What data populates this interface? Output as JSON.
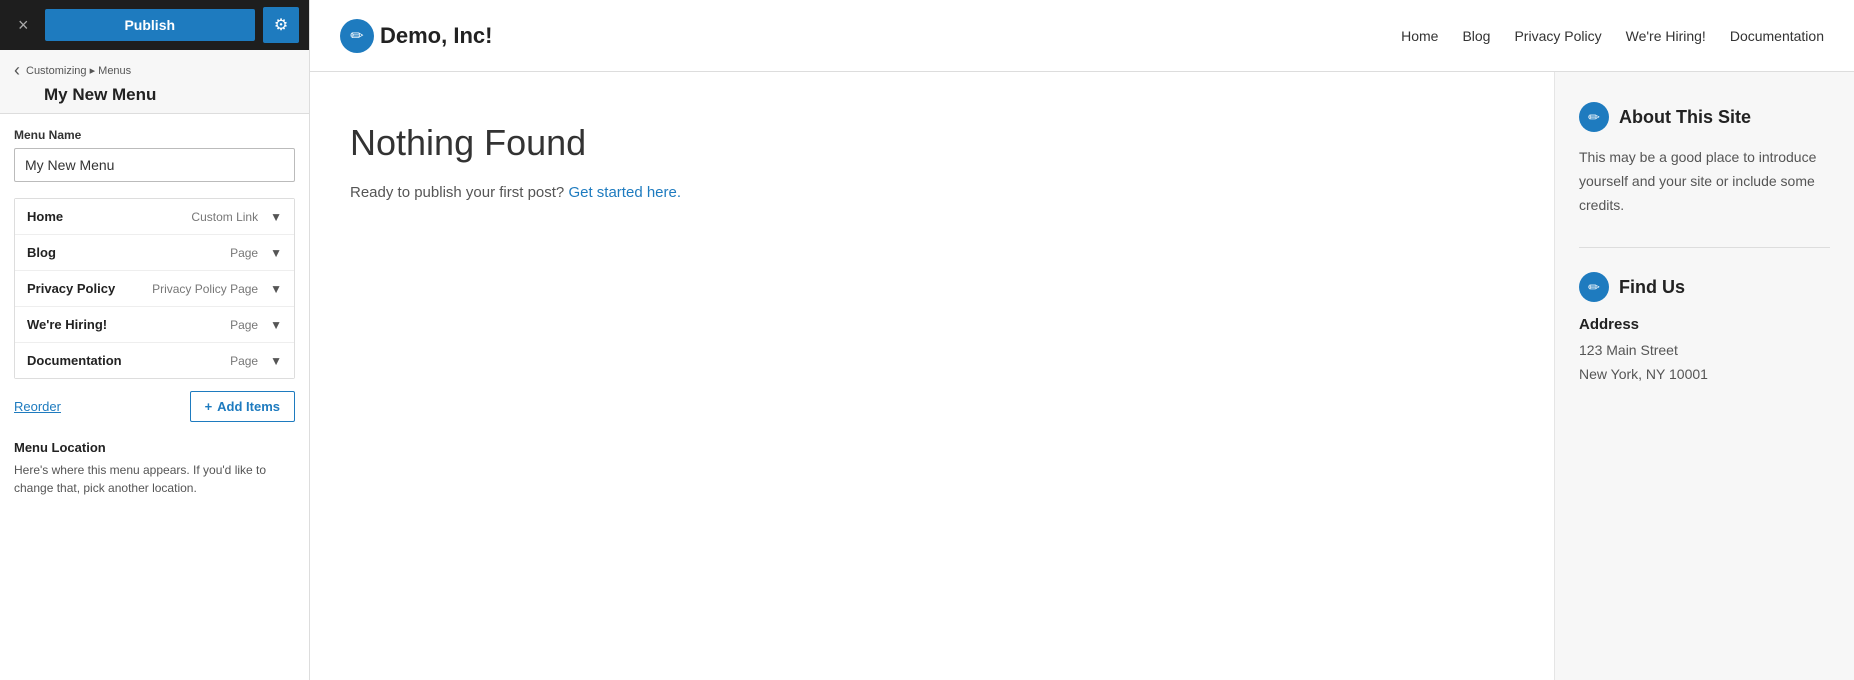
{
  "topbar": {
    "close_icon": "×",
    "publish_label": "Publish",
    "gear_icon": "⚙"
  },
  "sidebar": {
    "back_icon": "‹",
    "breadcrumb": "Customizing ▸ Menus",
    "section_title": "My New Menu",
    "menu_name_label": "Menu Name",
    "menu_name_value": "My New Menu",
    "menu_items": [
      {
        "name": "Home",
        "type": "Custom Link"
      },
      {
        "name": "Blog",
        "type": "Page"
      },
      {
        "name": "Privacy Policy",
        "type": "Privacy Policy Page"
      },
      {
        "name": "We're Hiring!",
        "type": "Page"
      },
      {
        "name": "Documentation",
        "type": "Page"
      }
    ],
    "reorder_label": "Reorder",
    "add_items_icon": "+",
    "add_items_label": "Add Items",
    "menu_location_title": "Menu Location",
    "menu_location_desc": "Here's where this menu appears. If you'd like to change that, pick another location."
  },
  "preview": {
    "header": {
      "pencil_icon": "✏",
      "site_title": "Demo, Inc!",
      "nav_items": [
        "Home",
        "Blog",
        "Privacy Policy",
        "We're Hiring!",
        "Documentation"
      ]
    },
    "main": {
      "nothing_found_title": "Nothing Found",
      "nothing_found_text": "Ready to publish your first post?",
      "nothing_found_link": "Get started here."
    },
    "sidebar_widgets": [
      {
        "id": "about",
        "pencil_icon": "✏",
        "title": "About This Site",
        "text": "This may be a good place to introduce yourself and your site or include some credits."
      },
      {
        "id": "findus",
        "pencil_icon": "✏",
        "title": "Find Us",
        "address_label": "Address",
        "address_lines": [
          "123 Main Street",
          "New York, NY 10001"
        ]
      }
    ]
  }
}
